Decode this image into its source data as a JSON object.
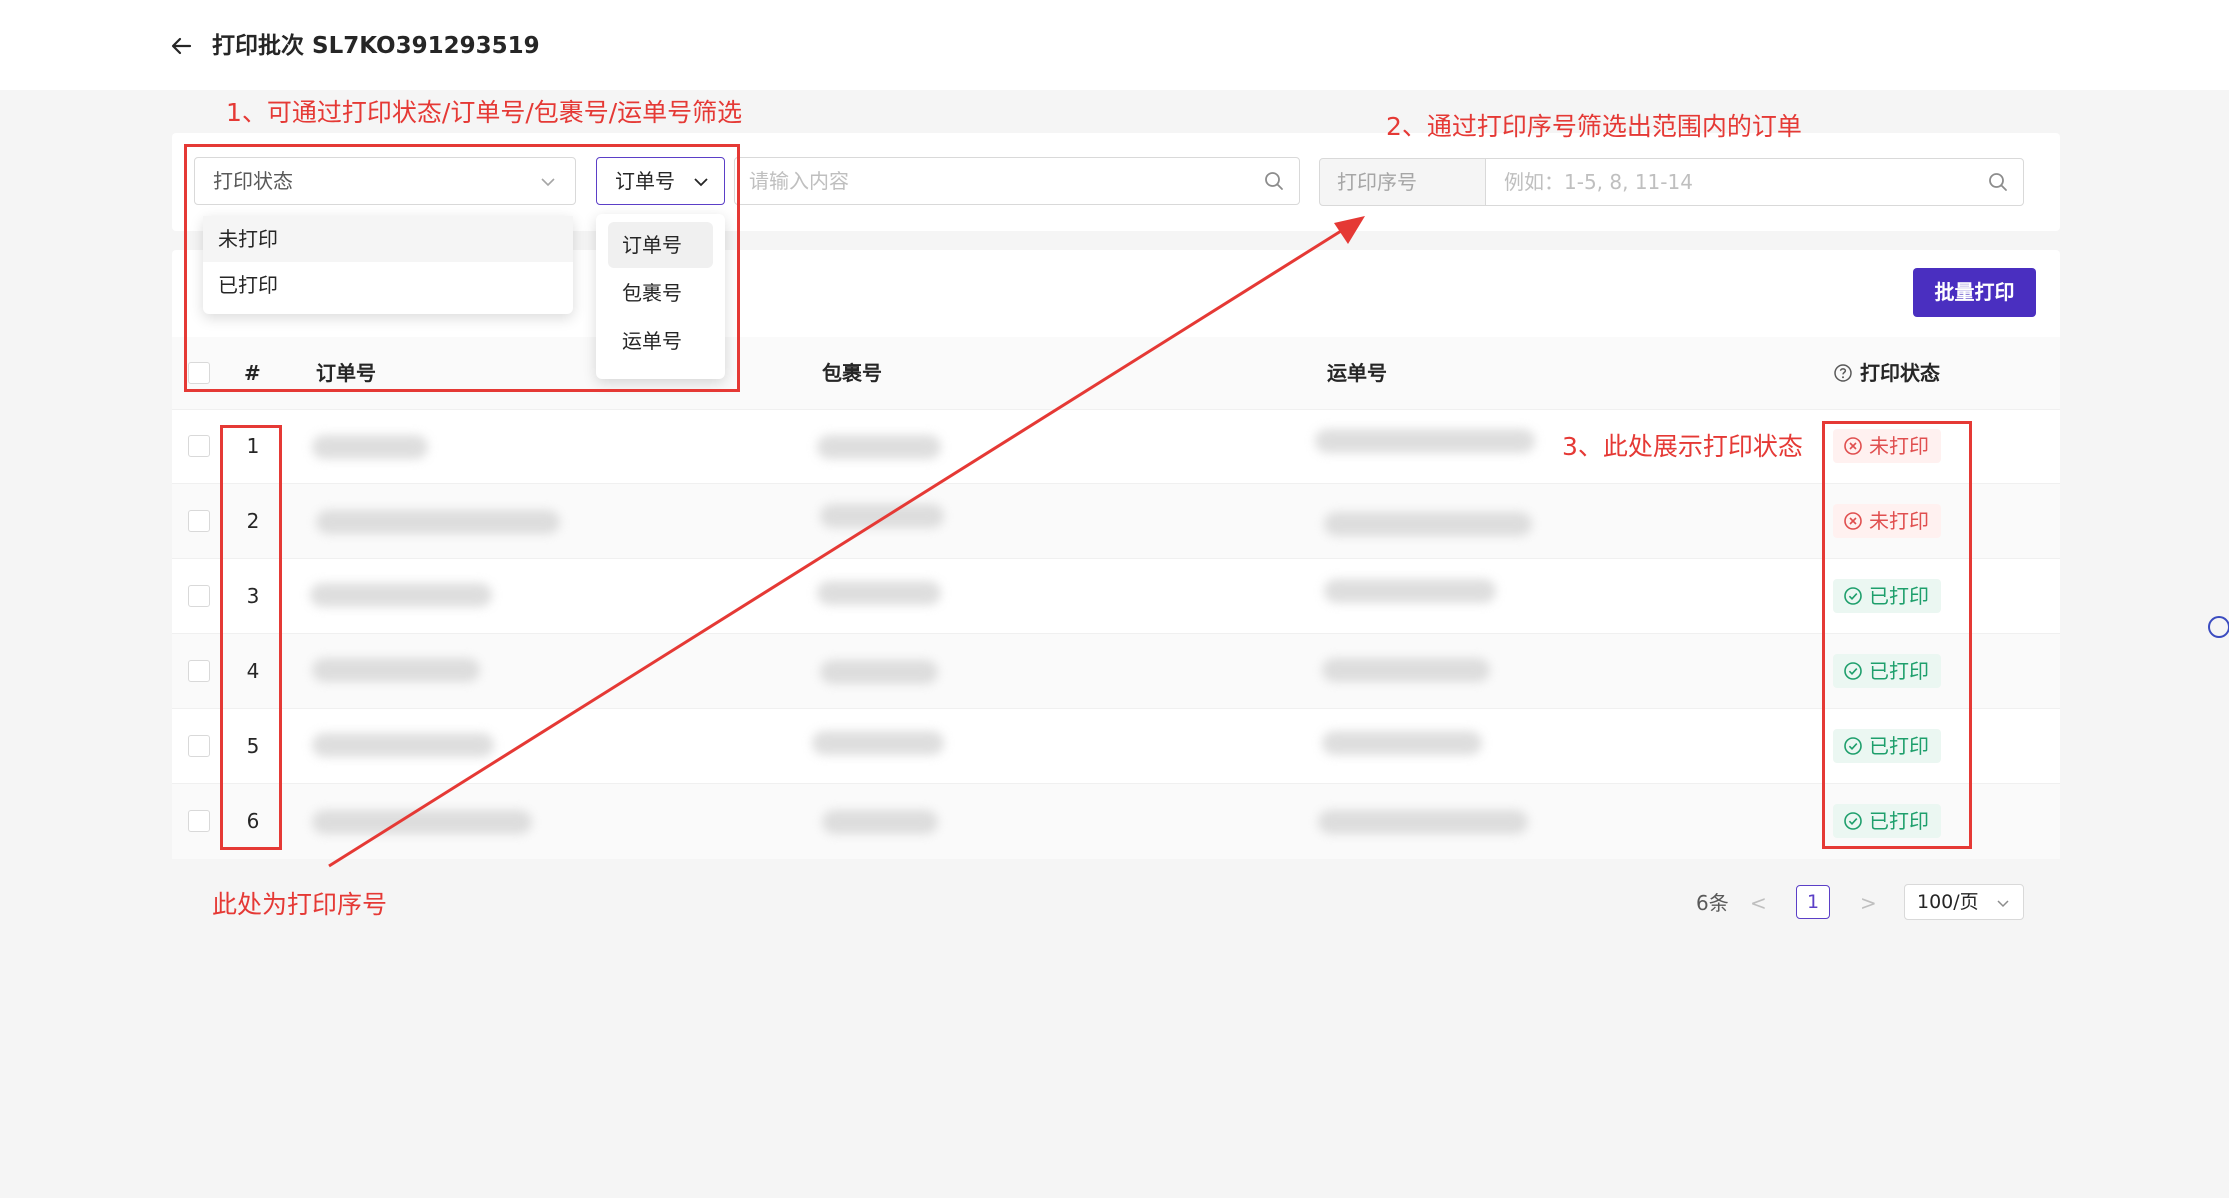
{
  "header": {
    "title": "打印批次 SL7KO391293519"
  },
  "filters": {
    "status_placeholder": "打印状态",
    "status_options": [
      "未打印",
      "已打印"
    ],
    "type_selected": "订单号",
    "type_options": [
      "订单号",
      "包裹号",
      "运单号"
    ],
    "keyword_placeholder": "请输入内容",
    "seq_addon": "打印序号",
    "seq_placeholder": "例如：1-5, 8, 11-14"
  },
  "toolbar": {
    "batch_print_label": "批量打印"
  },
  "table": {
    "columns": [
      "#",
      "订单号",
      "包裹号",
      "运单号",
      "打印状态"
    ],
    "rows": [
      {
        "index": "1",
        "status": "未打印",
        "printed": false
      },
      {
        "index": "2",
        "status": "未打印",
        "printed": false
      },
      {
        "index": "3",
        "status": "已打印",
        "printed": true
      },
      {
        "index": "4",
        "status": "已打印",
        "printed": true
      },
      {
        "index": "5",
        "status": "已打印",
        "printed": true
      },
      {
        "index": "6",
        "status": "已打印",
        "printed": true
      }
    ]
  },
  "pagination": {
    "total": "6条",
    "prev": "<",
    "current": "1",
    "next": ">",
    "page_size": "100/页"
  },
  "annotations": {
    "a1": "1、可通过打印状态/订单号/包裹号/运单号筛选",
    "a2": "2、通过打印序号筛选出范围内的订单",
    "a3": "3、此处展示打印状态",
    "a4": "此处为打印序号"
  },
  "colors": {
    "primary": "#4a2fc0",
    "annotation_red": "#e53935",
    "unprinted_text": "#e04f4f",
    "printed_text": "#1e9f6c"
  }
}
